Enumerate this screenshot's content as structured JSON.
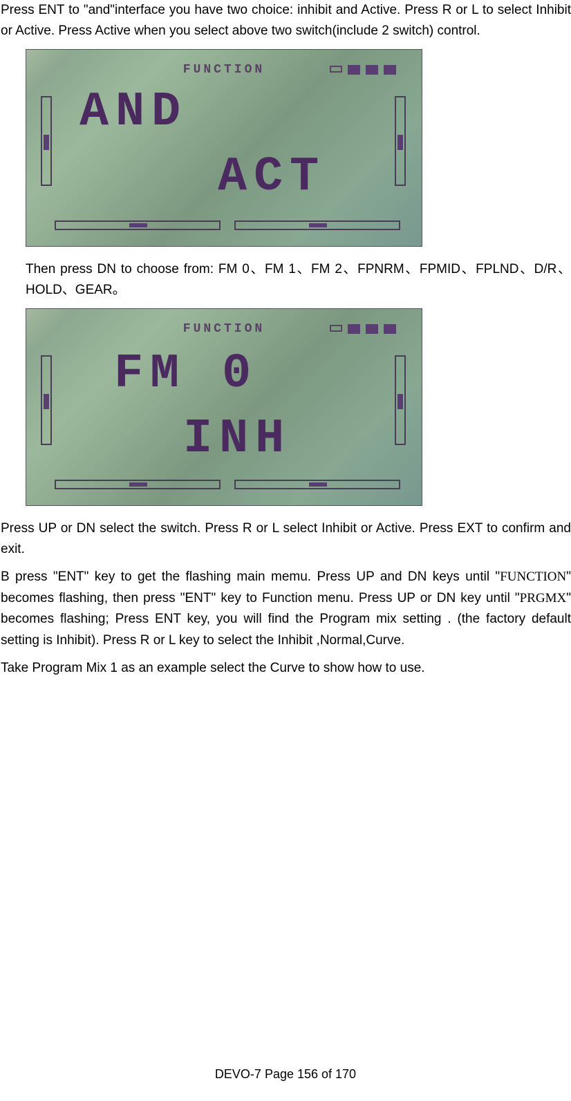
{
  "para1": "Press ENT to \"and\"interface you have two choice: inhibit and Active. Press R or L to select Inhibit or Active. Press Active when you select above two switch(include 2 switch) control.",
  "lcd1": {
    "title": "FUNCTION",
    "top": "AND",
    "bottom": "ACT"
  },
  "para2": "Then press DN to choose from: FM 0、FM 1、FM 2、FPNRM、FPMID、FPLND、D/R、HOLD、GEAR。",
  "lcd2": {
    "title": "FUNCTION",
    "top": "FM  0",
    "bottom": "INH"
  },
  "para3": "Press UP or DN select the switch. Press R or L select Inhibit or Active. Press EXT to confirm and exit.",
  "para4_a": "B   press \"ENT\" key to get the flashing main memu. Press UP and DN keys until \"",
  "para4_func1": "FUNCTION",
  "para4_b": "\" becomes flashing, then press \"ENT\" key to Function menu. Press UP or DN key until \"",
  "para4_func2": "PRGMX",
  "para4_c": "\" becomes flashing; Press ENT key, you will find the Program mix setting . (the factory default setting is Inhibit). Press R or L key to select the Inhibit ,Normal,Curve.",
  "para5": "Take Program Mix 1 as an example select the Curve to show how to use.",
  "footer": "DEVO-7     Page 156 of 170"
}
